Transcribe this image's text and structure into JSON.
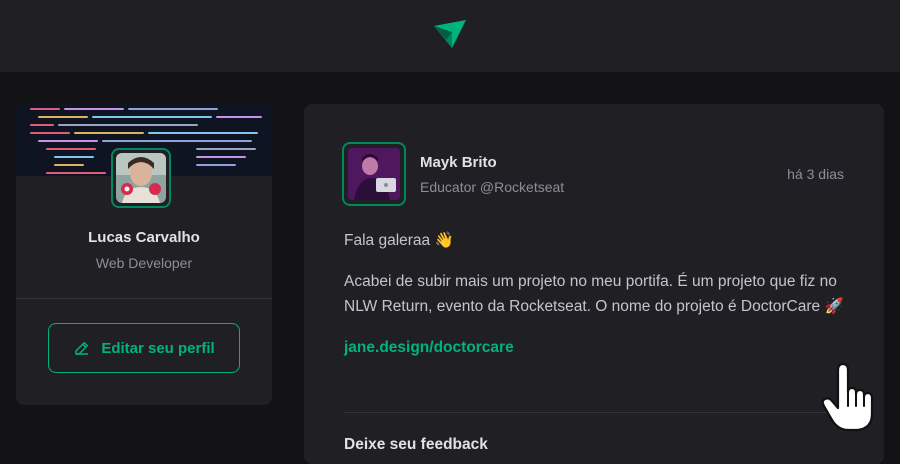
{
  "brand": {
    "accent": "#00b37e",
    "accent_dark": "#00875f",
    "icon": "logo-icon"
  },
  "profile": {
    "name": "Lucas Carvalho",
    "role": "Web Developer",
    "edit_label": "Editar seu perfil",
    "edit_icon": "pencil-icon"
  },
  "post": {
    "author_name": "Mayk Brito",
    "author_role": "Educator @Rocketseat",
    "time": "há 3 dias",
    "paragraph_1": "Fala galeraa 👋",
    "paragraph_2": "Acabei de subir mais um projeto no meu portifa. É um projeto que fiz no NLW Return, evento da Rocketseat. O nome do projeto é DoctorCare 🚀",
    "link": "jane.design/doctorcare",
    "feedback_title": "Deixe seu feedback"
  },
  "cursor": {
    "icon": "hand-cursor-icon"
  }
}
